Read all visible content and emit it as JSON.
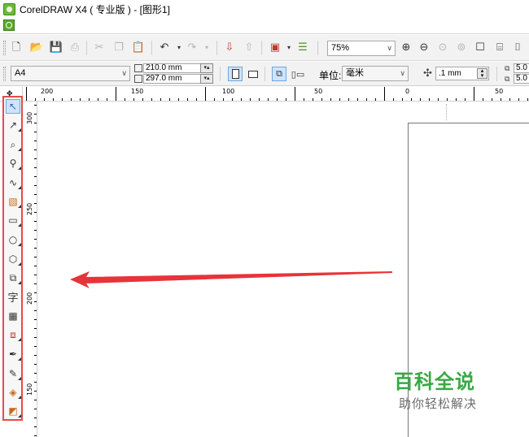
{
  "window": {
    "title": "CorelDRAW X4 ( 专业版 ) - [图形1]",
    "app_icon": "coreldraw-logo-icon",
    "doc_icon": "document-icon"
  },
  "standard_toolbar": {
    "buttons": [
      "new-icon",
      "open-icon",
      "save-icon",
      "print-icon",
      "cut-icon",
      "copy-icon",
      "paste-icon",
      "undo-icon",
      "redo-icon",
      "import-icon",
      "export-icon",
      "application-launcher-icon",
      "welcome-screen-icon"
    ],
    "zoom_level": "75%",
    "zoom_buttons": [
      "zoom-in-icon",
      "zoom-out-icon",
      "zoom-selected-icon",
      "zoom-all-icon",
      "zoom-page-icon",
      "zoom-width-icon",
      "zoom-height-icon"
    ]
  },
  "property_bar": {
    "paper_type": "A4",
    "page_width": "210.0 mm",
    "page_height": "297.0 mm",
    "orientation": "portrait",
    "unit_label": "单位:",
    "unit_value": "毫米",
    "nudge_value": ".1 mm",
    "duplicate_x": "5.0",
    "duplicate_y": "5.0"
  },
  "rulers": {
    "horizontal_labels": [
      "200",
      "150",
      "100",
      "50",
      "0",
      "50"
    ],
    "vertical_labels": [
      "300",
      "250",
      "200",
      "150"
    ]
  },
  "toolbox": {
    "tools": [
      "pick-tool-icon",
      "shape-tool-icon",
      "crop-tool-icon",
      "zoom-tool-icon",
      "freehand-tool-icon",
      "smart-fill-tool-icon",
      "rectangle-tool-icon",
      "ellipse-tool-icon",
      "polygon-tool-icon",
      "basic-shapes-tool-icon",
      "text-tool-icon",
      "table-tool-icon",
      "interactive-blend-tool-icon",
      "eyedropper-tool-icon",
      "outline-tool-icon",
      "fill-tool-icon",
      "interactive-fill-tool-icon"
    ],
    "text_tool_glyph": "字",
    "selected_tool": "pick-tool-icon",
    "highlight_color": "#e84a4a"
  },
  "annotation": {
    "arrow_color": "#e8333a"
  },
  "watermark": {
    "title": "百科全说",
    "subtitle": "助你轻松解决",
    "title_color": "#39a845"
  }
}
